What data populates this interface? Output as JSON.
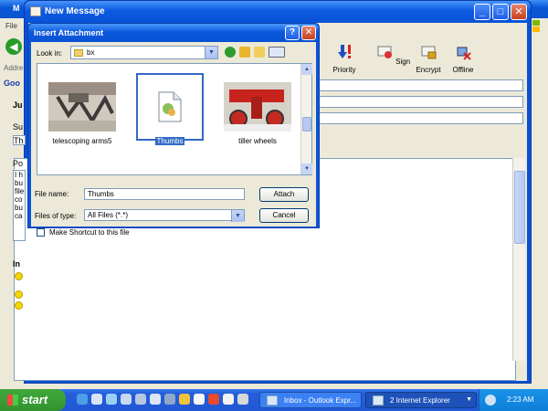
{
  "ie": {
    "title": "M",
    "menu_file": "File",
    "address_label": "Addre",
    "google_label": "Goo"
  },
  "new_message": {
    "title": "New Message",
    "toolbar": {
      "priority": "Priority",
      "sign": "Sign",
      "encrypt": "Encrypt",
      "offline": "Offline"
    },
    "partial_labels": {
      "from": "Ju",
      "subject": "Su",
      "subject_value": "Th",
      "body_lines": [
        "Po",
        "I h",
        "bu",
        "file",
        "co",
        "bu",
        "ca"
      ],
      "section": "In"
    }
  },
  "dialog": {
    "title": "Insert Attachment",
    "look_in_label": "Look in:",
    "look_in_value": "bx",
    "files": [
      {
        "name": "telescoping arms5",
        "type": "photo"
      },
      {
        "name": "Thumbs",
        "type": "file",
        "selected": true
      },
      {
        "name": "tiller wheels",
        "type": "photo"
      }
    ],
    "file_name_label": "File name:",
    "file_name_value": "Thumbs",
    "files_of_type_label": "Files of type:",
    "files_of_type_value": "All Files (*.*)",
    "attach_button": "Attach",
    "cancel_button": "Cancel",
    "shortcut_label": "Make Shortcut to this file",
    "help_button": "?",
    "close_button": "✕"
  },
  "taskbar": {
    "start": "start",
    "tasks": [
      {
        "label": "Inbox - Outlook Expr..."
      },
      {
        "label": "2 Internet Explorer"
      }
    ],
    "clock": "2:23 AM"
  },
  "colors": {
    "xp_blue": "#0a52d3",
    "selection": "#316ac5",
    "start_green": "#3fa83a"
  }
}
